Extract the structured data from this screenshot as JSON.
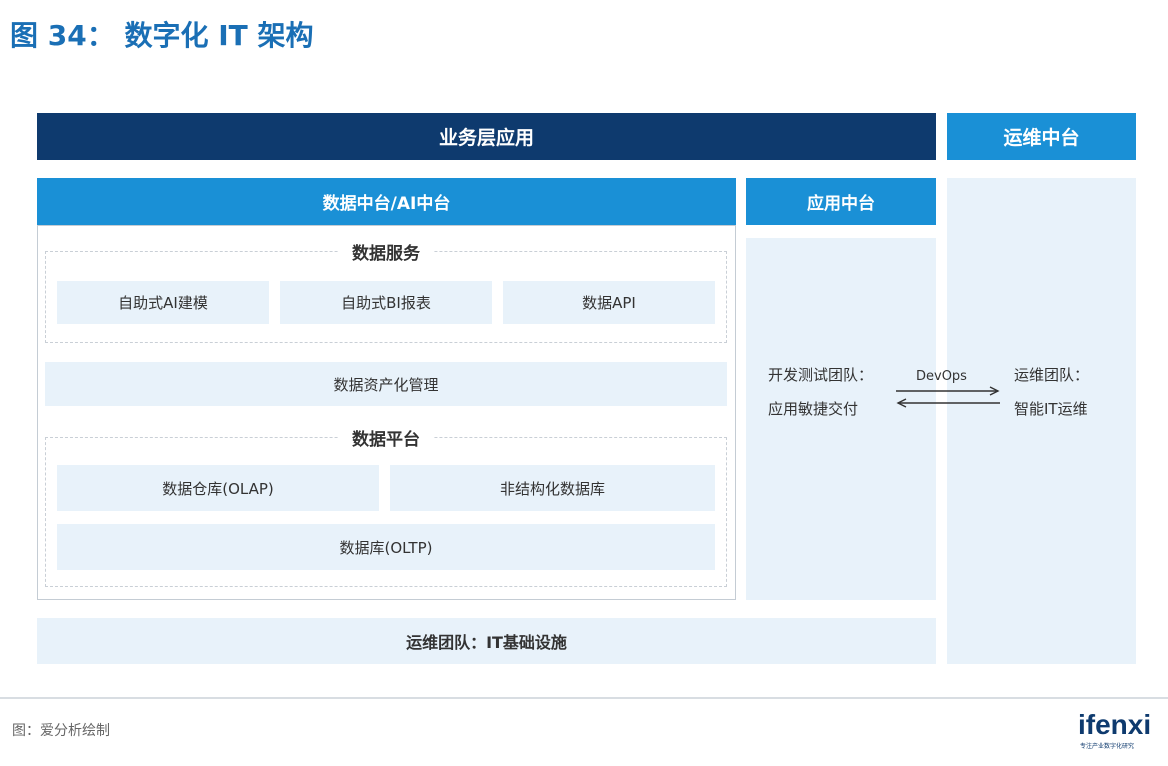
{
  "figure_title": "图 34：  数字化 IT 架构",
  "business_layer": "业务层应用",
  "ops_platform": "运维中台",
  "data_platform": {
    "title": "数据中台/AI中台",
    "data_services": {
      "title": "数据服务",
      "items": [
        "自助式AI建模",
        "自助式BI报表",
        "数据API"
      ]
    },
    "asset_management": "数据资产化管理",
    "data_platform_section": {
      "title": "数据平台",
      "items": [
        "数据仓库(OLAP)",
        "非结构化数据库",
        "数据库(OLTP)"
      ]
    }
  },
  "app_platform": {
    "title": "应用中台",
    "team_line1": "开发测试团队：",
    "team_line2": "应用敏捷交付"
  },
  "devops_label": "DevOps",
  "ops_team": {
    "line1": "运维团队：",
    "line2": "智能IT运维"
  },
  "infrastructure": "运维团队：IT基础设施",
  "source": "图：爱分析绘制",
  "logo": {
    "text": "ifenxi",
    "tagline": "专注产业数字化研究",
    "color": "#0e3a6e"
  },
  "colors": {
    "dark_navy": "#0e3a6e",
    "medium_blue": "#1a90d6",
    "pale_blue": "#e8f2fa",
    "title_blue": "#1a6fb5"
  }
}
